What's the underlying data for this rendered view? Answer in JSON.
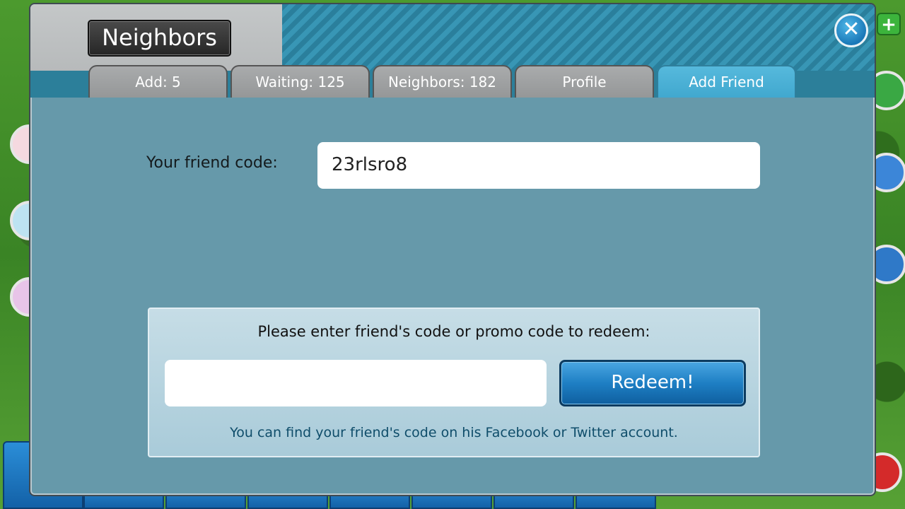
{
  "dialog": {
    "title": "Neighbors",
    "close_icon": "close-icon"
  },
  "tabs": [
    {
      "label": "Add: 5",
      "active": false
    },
    {
      "label": "Waiting: 125",
      "active": false
    },
    {
      "label": "Neighbors: 182",
      "active": false
    },
    {
      "label": "Profile",
      "active": false
    },
    {
      "label": "Add Friend",
      "active": true
    }
  ],
  "friend_code": {
    "label": "Your friend code:",
    "value": "23rlsro8"
  },
  "redeem": {
    "prompt": "Please enter friend's code or promo code to redeem:",
    "input_value": "",
    "input_placeholder": "",
    "button_label": "Redeem!",
    "hint": "You can find your friend's code on his Facebook or Twitter account."
  },
  "colors": {
    "accent_tab": "#41a8cf",
    "panel": "#6699aa",
    "button": "#1e7fc4"
  }
}
